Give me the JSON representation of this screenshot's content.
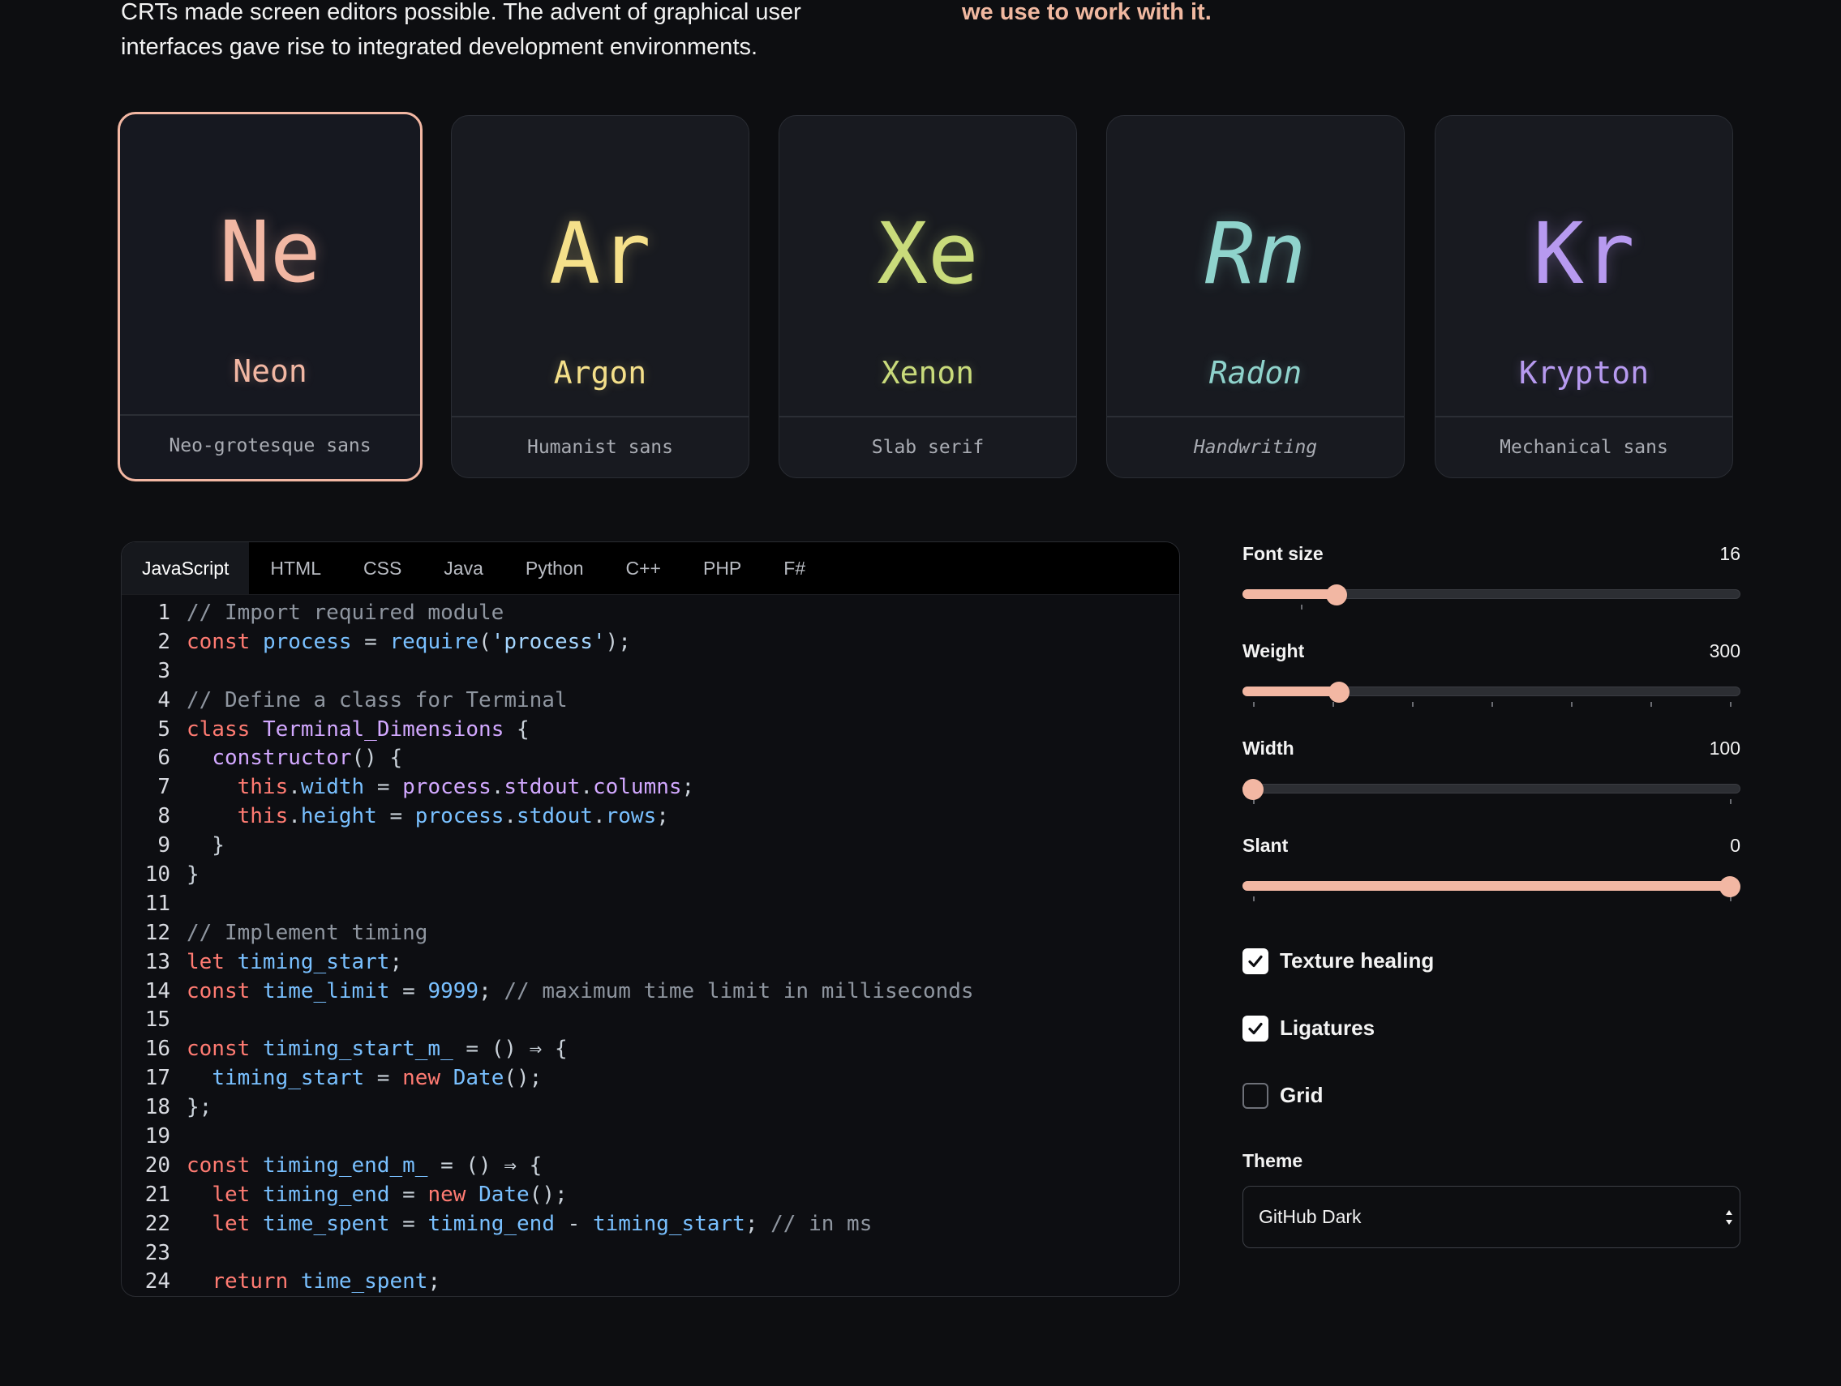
{
  "intro": {
    "left_text": "CRTs made screen editors possible. The advent of graphical user interfaces gave rise to integrated development environments.",
    "right_text": "we use to work with it."
  },
  "fonts": [
    {
      "symbol": "Ne",
      "name": "Neon",
      "classification": "Neo-grotesque sans",
      "color": "#f2b7a3",
      "selected": true
    },
    {
      "symbol": "Ar",
      "name": "Argon",
      "classification": "Humanist sans",
      "color": "#f5e08a",
      "selected": false
    },
    {
      "symbol": "Xe",
      "name": "Xenon",
      "classification": "Slab serif",
      "color": "#c9db7b",
      "selected": false
    },
    {
      "symbol": "Rn",
      "name": "Radon",
      "classification": "Handwriting",
      "color": "#8fd3cc",
      "selected": false
    },
    {
      "symbol": "Kr",
      "name": "Krypton",
      "classification": "Mechanical sans",
      "color": "#b79af0",
      "selected": false
    }
  ],
  "editor": {
    "tabs": [
      "JavaScript",
      "HTML",
      "CSS",
      "Java",
      "Python",
      "C++",
      "PHP",
      "F#"
    ],
    "active_tab": "JavaScript",
    "lines": [
      [
        [
          "comment",
          "// Import required module"
        ]
      ],
      [
        [
          "keyword",
          "const"
        ],
        [
          "plain",
          " "
        ],
        [
          "ident",
          "process"
        ],
        [
          "punct",
          " = "
        ],
        [
          "ident",
          "require"
        ],
        [
          "punct",
          "("
        ],
        [
          "string",
          "'process'"
        ],
        [
          "punct",
          ");"
        ]
      ],
      [],
      [
        [
          "comment",
          "// Define a class for Terminal"
        ]
      ],
      [
        [
          "keyword",
          "class"
        ],
        [
          "plain",
          " "
        ],
        [
          "class",
          "Terminal_Dimensions"
        ],
        [
          "punct",
          " {"
        ]
      ],
      [
        [
          "plain",
          "  "
        ],
        [
          "class",
          "constructor"
        ],
        [
          "punct",
          "() {"
        ]
      ],
      [
        [
          "plain",
          "    "
        ],
        [
          "keyword",
          "this"
        ],
        [
          "punct",
          "."
        ],
        [
          "ident",
          "width"
        ],
        [
          "punct",
          " = "
        ],
        [
          "class",
          "process"
        ],
        [
          "punct",
          "."
        ],
        [
          "class",
          "stdout"
        ],
        [
          "punct",
          "."
        ],
        [
          "class",
          "columns"
        ],
        [
          "punct",
          ";"
        ]
      ],
      [
        [
          "plain",
          "    "
        ],
        [
          "keyword",
          "this"
        ],
        [
          "punct",
          "."
        ],
        [
          "ident",
          "height"
        ],
        [
          "punct",
          " = "
        ],
        [
          "ident",
          "process"
        ],
        [
          "punct",
          "."
        ],
        [
          "ident",
          "stdout"
        ],
        [
          "punct",
          "."
        ],
        [
          "ident",
          "rows"
        ],
        [
          "punct",
          ";"
        ]
      ],
      [
        [
          "punct",
          "  }"
        ]
      ],
      [
        [
          "punct",
          "}"
        ]
      ],
      [],
      [
        [
          "comment",
          "// Implement timing"
        ]
      ],
      [
        [
          "keyword",
          "let"
        ],
        [
          "plain",
          " "
        ],
        [
          "ident",
          "timing_start"
        ],
        [
          "punct",
          ";"
        ]
      ],
      [
        [
          "keyword",
          "const"
        ],
        [
          "plain",
          " "
        ],
        [
          "ident",
          "time_limit"
        ],
        [
          "punct",
          " = "
        ],
        [
          "number",
          "9999"
        ],
        [
          "punct",
          "; "
        ],
        [
          "comment",
          "// maximum time limit in milliseconds"
        ]
      ],
      [],
      [
        [
          "keyword",
          "const"
        ],
        [
          "plain",
          " "
        ],
        [
          "ident",
          "timing_start_m_"
        ],
        [
          "punct",
          " = () ⇒ {"
        ]
      ],
      [
        [
          "plain",
          "  "
        ],
        [
          "ident",
          "timing_start"
        ],
        [
          "punct",
          " = "
        ],
        [
          "keyword",
          "new"
        ],
        [
          "plain",
          " "
        ],
        [
          "ident",
          "Date"
        ],
        [
          "punct",
          "();"
        ]
      ],
      [
        [
          "punct",
          "};"
        ]
      ],
      [],
      [
        [
          "keyword",
          "const"
        ],
        [
          "plain",
          " "
        ],
        [
          "ident",
          "timing_end_m_"
        ],
        [
          "punct",
          " = () ⇒ {"
        ]
      ],
      [
        [
          "plain",
          "  "
        ],
        [
          "keyword",
          "let"
        ],
        [
          "plain",
          " "
        ],
        [
          "ident",
          "timing_end"
        ],
        [
          "punct",
          " = "
        ],
        [
          "keyword",
          "new"
        ],
        [
          "plain",
          " "
        ],
        [
          "ident",
          "Date"
        ],
        [
          "punct",
          "();"
        ]
      ],
      [
        [
          "plain",
          "  "
        ],
        [
          "keyword",
          "let"
        ],
        [
          "plain",
          " "
        ],
        [
          "ident",
          "time_spent"
        ],
        [
          "punct",
          " = "
        ],
        [
          "ident",
          "timing_end"
        ],
        [
          "punct",
          " - "
        ],
        [
          "ident",
          "timing_start"
        ],
        [
          "punct",
          "; "
        ],
        [
          "comment",
          "// in ms"
        ]
      ],
      [],
      [
        [
          "plain",
          "  "
        ],
        [
          "keyword",
          "return"
        ],
        [
          "plain",
          " "
        ],
        [
          "ident",
          "time_spent"
        ],
        [
          "punct",
          ";"
        ]
      ]
    ]
  },
  "controls": {
    "sliders": [
      {
        "label": "Font size",
        "value": "16",
        "level": 0.175,
        "ticks": 1
      },
      {
        "label": "Weight",
        "value": "300",
        "level": 0.18,
        "ticks": 7
      },
      {
        "label": "Width",
        "value": "100",
        "level": 0.0,
        "ticks": 2
      },
      {
        "label": "Slant",
        "value": "0",
        "level": 1.0,
        "ticks": 2
      }
    ],
    "checkboxes": [
      {
        "label": "Texture healing",
        "checked": true
      },
      {
        "label": "Ligatures",
        "checked": true
      },
      {
        "label": "Grid",
        "checked": false
      }
    ],
    "theme_label": "Theme",
    "theme_value": "GitHub Dark"
  },
  "colors": {
    "accent": "#f2b7a3",
    "background": "#0d0e11"
  }
}
